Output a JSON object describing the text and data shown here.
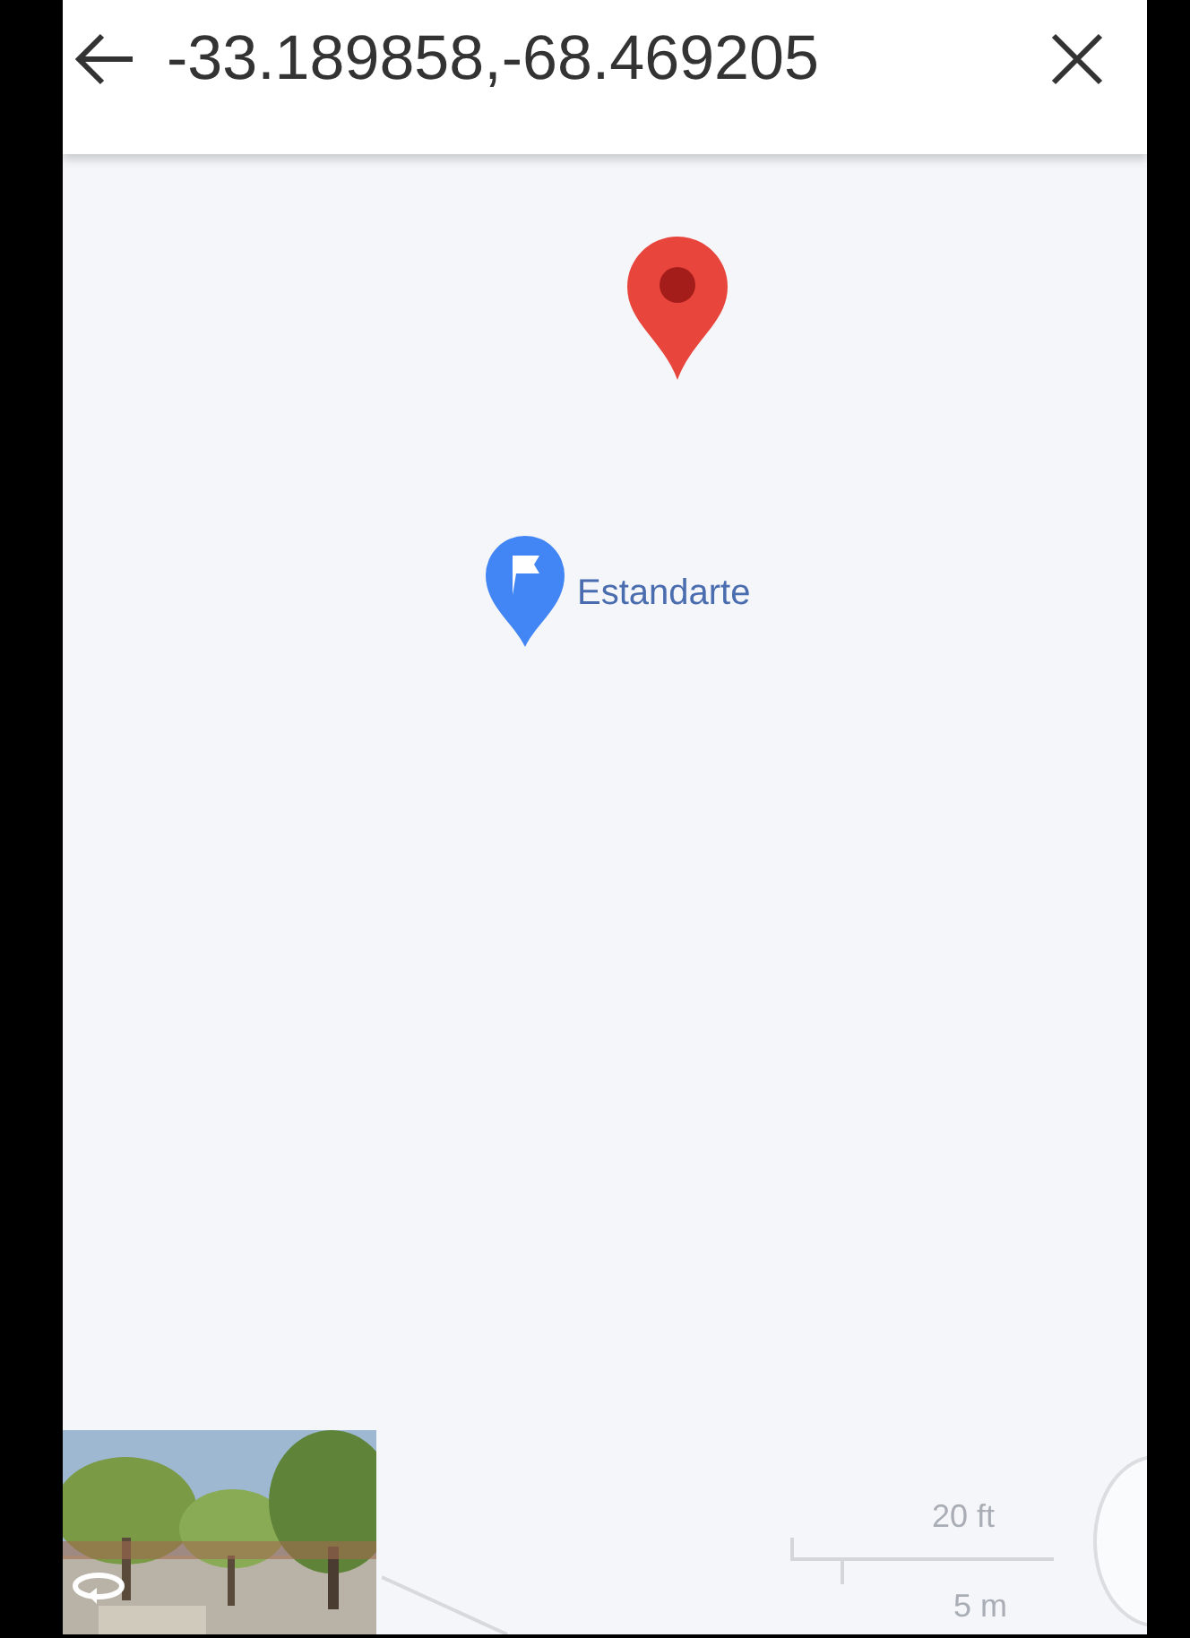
{
  "search_bar": {
    "query": "-33.189858,-68.469205"
  },
  "map": {
    "place_label": "Estandarte",
    "scale": {
      "imperial": "20 ft",
      "metric": "5 m"
    }
  }
}
